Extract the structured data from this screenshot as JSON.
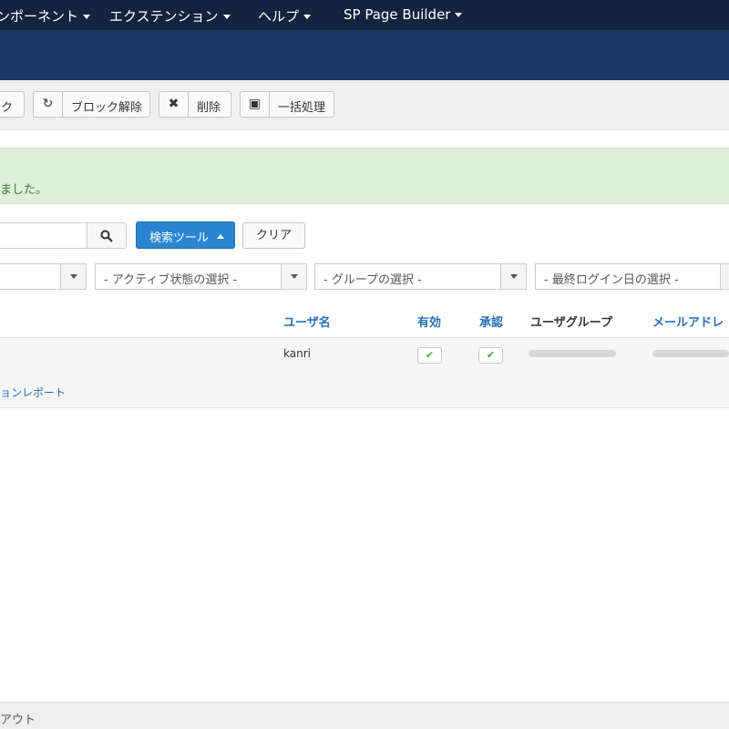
{
  "nav": {
    "items": [
      {
        "label": "ンポーネント"
      },
      {
        "label": "エクステンション"
      },
      {
        "label": "ヘルプ"
      },
      {
        "label": "SP Page Builder"
      }
    ]
  },
  "toolbar": {
    "block_label": "ク",
    "unblock_label": "ブロック解除",
    "delete_label": "削除",
    "batch_label": "一括処理"
  },
  "message": {
    "text": "ました。"
  },
  "search": {
    "value": "",
    "tools_label": "検索ツール",
    "clear_label": "クリア"
  },
  "filters": [
    {
      "selected": ""
    },
    {
      "selected": "- アクティブ状態の選択 -"
    },
    {
      "selected": "- グループの選択 -"
    },
    {
      "selected": "- 最終ログイン日の選択 -"
    }
  ],
  "table": {
    "headers": [
      "ユーザ名",
      "有効",
      "承認",
      "ユーザグループ",
      "メールアドレ"
    ],
    "rows": [
      {
        "username": "kanri",
        "enabled": true,
        "activated": true,
        "link": "ョンレポート"
      }
    ]
  },
  "footer": {
    "text": "アウト"
  },
  "colors": {
    "nav_bg": "#14233f",
    "header_bg": "#1a3867",
    "primary": "#2a85d0",
    "success_bg": "#dff0d8",
    "link": "#2a6fb5"
  }
}
